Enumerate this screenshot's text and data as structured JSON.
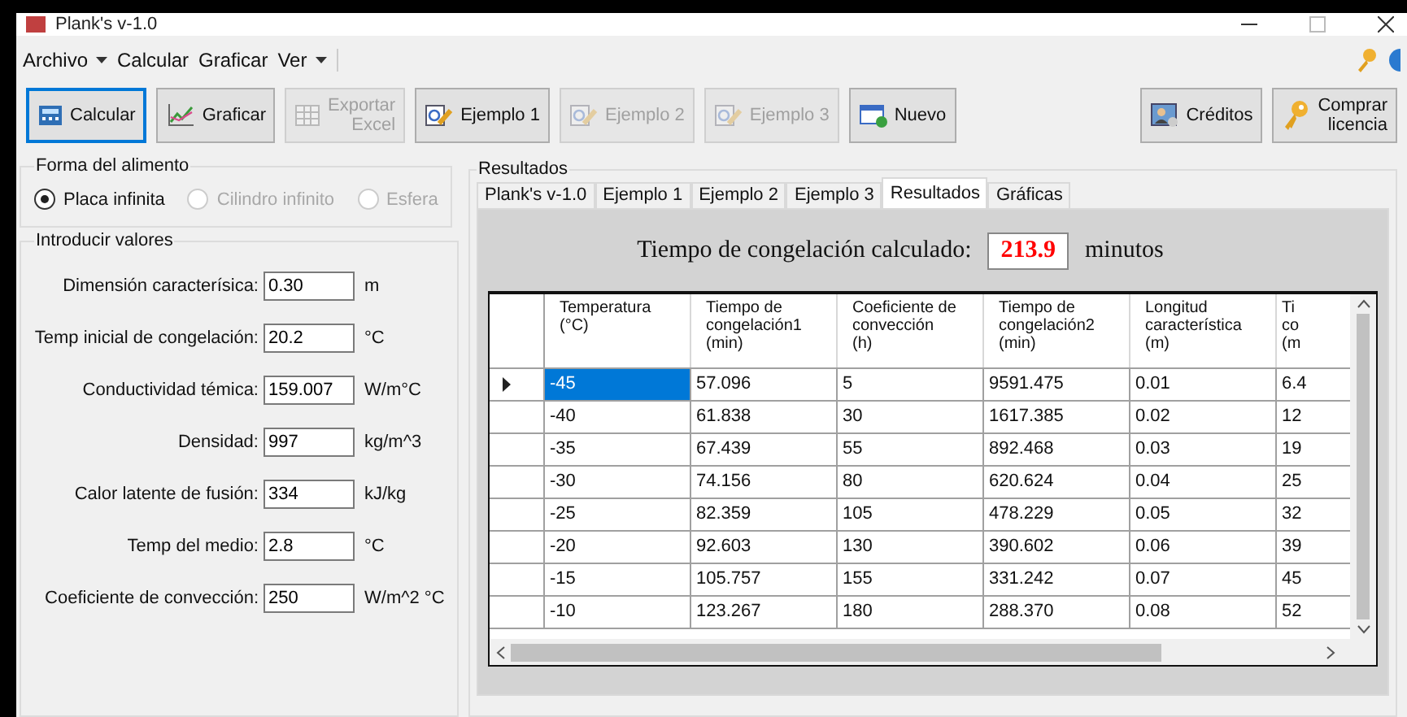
{
  "window": {
    "title": "Plank's v-1.0"
  },
  "menu": [
    {
      "label": "Archivo",
      "dropdown": true
    },
    {
      "label": "Calcular",
      "dropdown": false
    },
    {
      "label": "Graficar",
      "dropdown": false
    },
    {
      "label": "Ver",
      "dropdown": true
    }
  ],
  "toolbar": [
    {
      "label": "Calcular",
      "kind": "calc",
      "disabled": false,
      "focused": true
    },
    {
      "label": "Graficar",
      "kind": "chart",
      "disabled": false,
      "focused": false
    },
    {
      "label": "Exportar\nExcel",
      "kind": "excel",
      "disabled": true,
      "focused": false
    },
    {
      "label": "Ejemplo 1",
      "kind": "example",
      "disabled": false,
      "focused": false
    },
    {
      "label": "Ejemplo 2",
      "kind": "example",
      "disabled": true,
      "focused": false
    },
    {
      "label": "Ejemplo 3",
      "kind": "example",
      "disabled": true,
      "focused": false
    },
    {
      "label": "Nuevo",
      "kind": "new",
      "disabled": false,
      "focused": false
    }
  ],
  "toolbar_right": [
    {
      "label": "Créditos",
      "kind": "person"
    },
    {
      "label": "Comprar\nlicencia",
      "kind": "key"
    }
  ],
  "shape_group": {
    "title": "Forma del alimento",
    "options": [
      {
        "label": "Placa infinita",
        "selected": true,
        "disabled": false
      },
      {
        "label": "Cilindro infinito",
        "selected": false,
        "disabled": true
      },
      {
        "label": "Esfera",
        "selected": false,
        "disabled": true
      }
    ]
  },
  "inputs_group": {
    "title": "Introducir valores",
    "fields": [
      {
        "label": "Dimensión caracterísica:",
        "value": "0.30",
        "unit": "m"
      },
      {
        "label": "Temp inicial de congelación:",
        "value": "20.2",
        "unit": "°C"
      },
      {
        "label": "Conductividad témica:",
        "value": "159.007",
        "unit": "W/m°C"
      },
      {
        "label": "Densidad:",
        "value": "997",
        "unit": "kg/m^3"
      },
      {
        "label": "Calor latente de fusión:",
        "value": "334",
        "unit": "kJ/kg"
      },
      {
        "label": "Temp del medio:",
        "value": "2.8",
        "unit": "°C"
      },
      {
        "label": "Coeficiente de convección:",
        "value": "250",
        "unit": "W/m^2 °C"
      }
    ]
  },
  "results_group": {
    "title": "Resultados",
    "tabs": [
      {
        "label": "Plank's v-1.0",
        "selected": false
      },
      {
        "label": "Ejemplo 1",
        "selected": false
      },
      {
        "label": "Ejemplo 2",
        "selected": false
      },
      {
        "label": "Ejemplo 3",
        "selected": false
      },
      {
        "label": "Resultados",
        "selected": true
      },
      {
        "label": "Gráficas",
        "selected": false
      }
    ],
    "result_label": "Tiempo de congelación calculado:",
    "result_value": "213.9",
    "result_unit": "minutos",
    "table": {
      "columns": [
        "Temperatura\n(°C)",
        "Tiempo de\ncongelación1\n(min)",
        "Coeficiente de\nconvección\n(h)",
        "Tiempo de\ncongelación2\n(min)",
        "Longitud\ncaracterística\n(m)",
        "Ti\nco\n(m"
      ],
      "rows": [
        {
          "selected": true,
          "cells": [
            "-45",
            "57.096",
            "5",
            "9591.475",
            "0.01",
            "6.4"
          ]
        },
        {
          "selected": false,
          "cells": [
            "-40",
            "61.838",
            "30",
            "1617.385",
            "0.02",
            "12"
          ]
        },
        {
          "selected": false,
          "cells": [
            "-35",
            "67.439",
            "55",
            "892.468",
            "0.03",
            "19"
          ]
        },
        {
          "selected": false,
          "cells": [
            "-30",
            "74.156",
            "80",
            "620.624",
            "0.04",
            "25"
          ]
        },
        {
          "selected": false,
          "cells": [
            "-25",
            "82.359",
            "105",
            "478.229",
            "0.05",
            "32"
          ]
        },
        {
          "selected": false,
          "cells": [
            "-20",
            "92.603",
            "130",
            "390.602",
            "0.06",
            "39"
          ]
        },
        {
          "selected": false,
          "cells": [
            "-15",
            "105.757",
            "155",
            "331.242",
            "0.07",
            "45"
          ]
        },
        {
          "selected": false,
          "cells": [
            "-10",
            "123.267",
            "180",
            "288.370",
            "0.08",
            "52"
          ]
        }
      ]
    }
  }
}
